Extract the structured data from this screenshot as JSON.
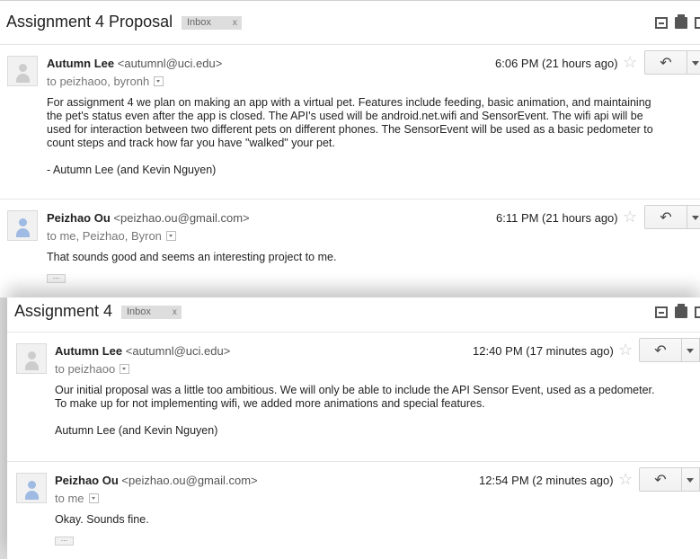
{
  "thread1": {
    "subject": "Assignment 4 Proposal",
    "label": "Inbox",
    "label_close": "x",
    "messages": [
      {
        "sender_name": "Autumn Lee",
        "sender_email": "<autumnl@uci.edu>",
        "to": "to peizhaoo, byronh",
        "time": "6:06 PM (21 hours ago)",
        "body": [
          "For assignment 4 we plan on making an app with a virtual pet.  Features include feeding, basic animation, and maintaining",
          "the pet's status even after the app is closed.  The API's used will be android.net.wifi and SensorEvent.  The wifi api will be",
          "used for interaction between two different pets on different phones.  The SensorEvent will be used as a basic pedometer to",
          "count steps and track how far you have \"walked\" your pet.",
          "",
          "- Autumn Lee (and Kevin Nguyen)"
        ]
      },
      {
        "sender_name": "Peizhao Ou",
        "sender_email": "<peizhao.ou@gmail.com>",
        "to": "to me, Peizhao, Byron",
        "time": "6:11 PM (21 hours ago)",
        "body": [
          "That sounds good and seems an interesting project to me."
        ],
        "ellipsis": "..."
      }
    ]
  },
  "thread2": {
    "subject": "Assignment 4",
    "label": "Inbox",
    "label_close": "x",
    "messages": [
      {
        "sender_name": "Autumn Lee",
        "sender_email": "<autumnl@uci.edu>",
        "to": "to peizhaoo",
        "time": "12:40 PM (17 minutes ago)",
        "body": [
          "Our initial proposal was a little too ambitious.  We will only be able to include the API Sensor Event, used as a pedometer.",
          "To make up for not implementing wifi, we added more animations and special features.",
          "",
          "Autumn Lee (and Kevin Nguyen)"
        ]
      },
      {
        "sender_name": "Peizhao Ou",
        "sender_email": "<peizhao.ou@gmail.com>",
        "to": "to me",
        "time": "12:54 PM (2 minutes ago)",
        "body": [
          "Okay. Sounds fine."
        ],
        "ellipsis": "..."
      }
    ]
  },
  "icons": {
    "star": "☆",
    "reply": "↶"
  },
  "colors": {
    "avatar_default": "#cdcdcd",
    "avatar_blue": "#9fbbe4",
    "label_bg": "#dddddd"
  }
}
